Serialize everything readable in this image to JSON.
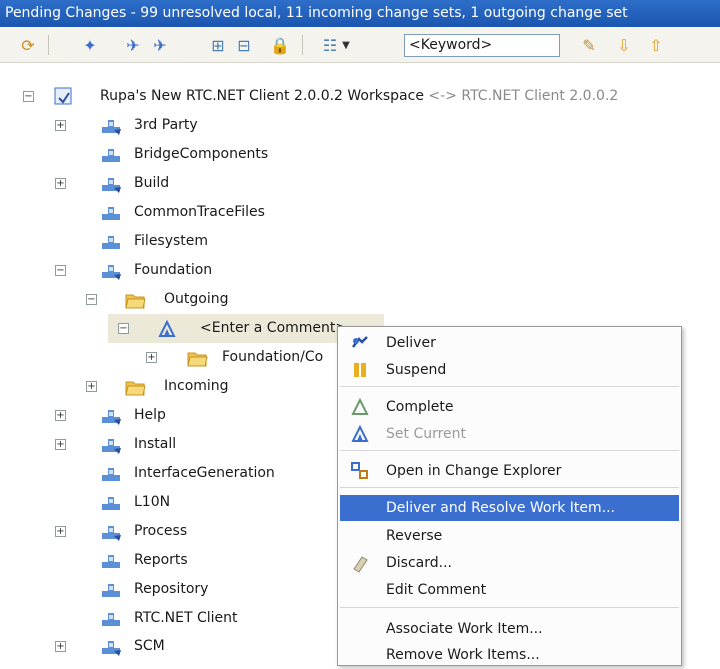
{
  "title": "Pending Changes - 99 unresolved local, 11 incoming change sets, 1 outgoing change set",
  "toolbar": {
    "keyword": "<Keyword>"
  },
  "workspace": {
    "name": "Rupa's New RTC.NET Client 2.0.0.2 Workspace",
    "suffix": "<-> RTC.NET Client 2.0.0.2"
  },
  "tree": {
    "third_party": "3rd Party",
    "bridge": "BridgeComponents",
    "build": "Build",
    "commontrace": "CommonTraceFiles",
    "filesystem": "Filesystem",
    "foundation": "Foundation",
    "outgoing": "Outgoing",
    "comment": "<Enter a Comment>",
    "foundation_co": "Foundation/Co",
    "incoming": "Incoming",
    "help": "Help",
    "install": "Install",
    "interfacegen": "InterfaceGeneration",
    "l10n": "L10N",
    "process": "Process",
    "reports": "Reports",
    "repository": "Repository",
    "rtcnet": "RTC.NET Client",
    "scm": "SCM"
  },
  "menu": {
    "deliver": "Deliver",
    "suspend": "Suspend",
    "complete": "Complete",
    "set_current": "Set Current",
    "open_explorer": "Open in Change Explorer",
    "deliver_resolve": "Deliver and Resolve Work Item...",
    "reverse": "Reverse",
    "discard": "Discard...",
    "edit_comment": "Edit Comment",
    "associate": "Associate Work Item...",
    "remove_items": "Remove Work Items..."
  },
  "icons": {
    "component": "component-icon",
    "component_change": "component-changed-icon",
    "folder": "folder-icon",
    "workspace": "workspace-icon"
  },
  "colors": {
    "title_bar": "#1b56b0",
    "selection": "#3a6fd0",
    "component": "#5b8fd6",
    "folder": "#f2c14e"
  }
}
